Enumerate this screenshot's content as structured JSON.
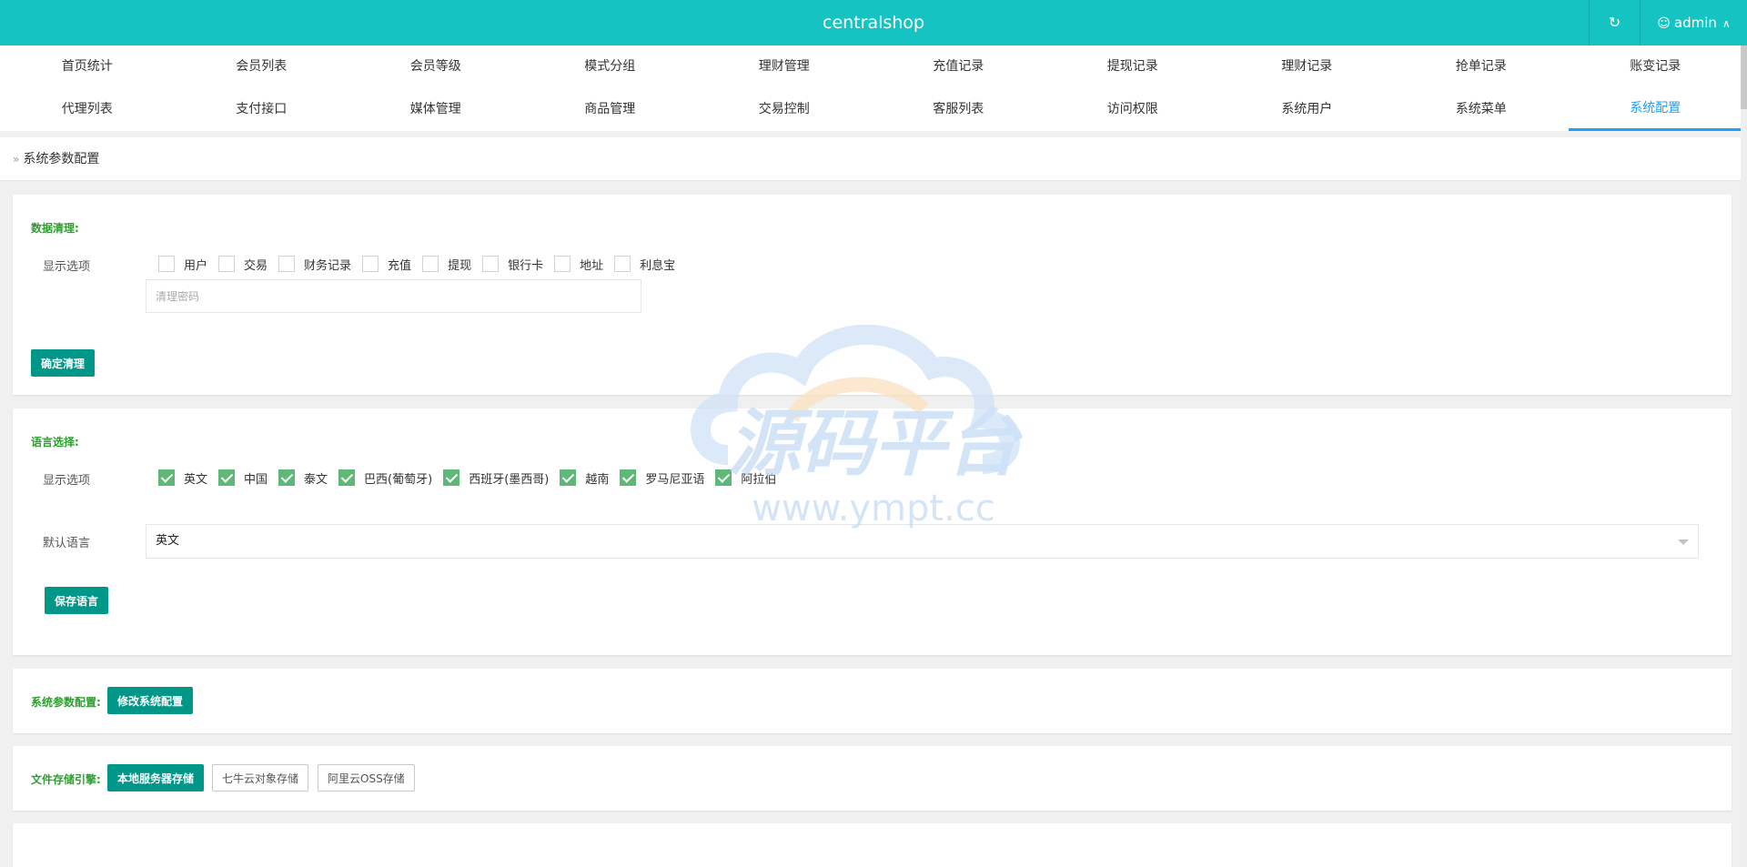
{
  "app": {
    "title": "centralshop",
    "user": "admin"
  },
  "icons": {
    "refresh": "refresh-icon",
    "user": "user-icon",
    "chevron": "chevron-up-icon"
  },
  "nav": {
    "row1": [
      "首页统计",
      "会员列表",
      "会员等级",
      "模式分组",
      "理财管理",
      "充值记录",
      "提现记录",
      "理财记录",
      "抢单记录",
      "账变记录"
    ],
    "row2": [
      "代理列表",
      "支付接口",
      "媒体管理",
      "商品管理",
      "交易控制",
      "客服列表",
      "访问权限",
      "系统用户",
      "系统菜单",
      "系统配置"
    ],
    "active": "系统配置"
  },
  "breadcrumb": "系统参数配置",
  "clean": {
    "title": "数据清理:",
    "label": "显示选项",
    "options": [
      "用户",
      "交易",
      "财务记录",
      "充值",
      "提现",
      "银行卡",
      "地址",
      "利息宝"
    ],
    "password_placeholder": "清理密码",
    "confirm_button": "确定清理"
  },
  "language": {
    "title": "语言选择:",
    "label": "显示选项",
    "options": [
      "英文",
      "中国",
      "泰文",
      "巴西(葡萄牙)",
      "西班牙(墨西哥)",
      "越南",
      "罗马尼亚语",
      "阿拉伯"
    ],
    "default_label": "默认语言",
    "default_value": "英文",
    "save_button": "保存语言"
  },
  "sysconfig": {
    "title": "系统参数配置:",
    "button": "修改系统配置"
  },
  "storage": {
    "title": "文件存储引擎:",
    "options": [
      "本地服务器存储",
      "七牛云对象存储",
      "阿里云OSS存储"
    ],
    "selected": "本地服务器存储"
  },
  "watermark": {
    "title": "源码平台",
    "url": "www.ympt.cc"
  },
  "colors": {
    "topbar": "#15c3c3",
    "accent": "#009688",
    "active_nav": "#1e9fff",
    "section_title": "#2e9e31",
    "checked": "#5fb878"
  }
}
